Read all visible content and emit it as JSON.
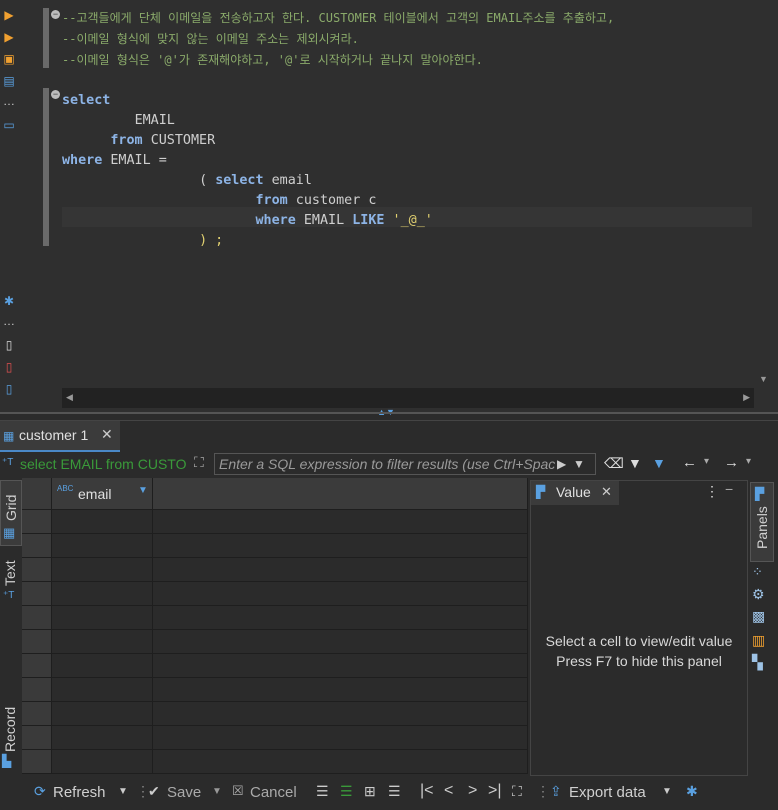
{
  "editor": {
    "comments": [
      "--고객들에게 단체 이메일을 전송하고자 한다. CUSTOMER 테이블에서 고객의 EMAIL주소를 추출하고,",
      "--이메일 형식에 맞지 않는 이메일 주소는 제외시켜라.",
      "--이메일 형식은 '@'가 존재해야하고, '@'로 시작하거나 끝나지 말아야한다."
    ],
    "sql": {
      "kw_select": "select",
      "col_email": "EMAIL",
      "kw_from": "from",
      "tbl_customer": "CUSTOMER",
      "kw_where": "where",
      "where_lhs": "EMAIL =",
      "paren_open": "( ",
      "kw_select2": "select",
      "col_email2": " email",
      "kw_from2": "from",
      "tbl_customer2": " customer c",
      "kw_where2": "where",
      "where2_lhs": " EMAIL ",
      "kw_like": "LIKE",
      "like_pattern": " '_@_'",
      "close": ") ;"
    }
  },
  "results": {
    "tab_label": "customer 1",
    "filter_sql": "select EMAIL from CUSTO",
    "filter_placeholder": "Enter a SQL expression to filter results (use Ctrl+Space)",
    "column_header": "email",
    "side_tabs": [
      "Grid",
      "Text",
      "Record"
    ],
    "value_panel": {
      "title": "Value",
      "hint_line1": "Select a cell to view/edit value",
      "hint_line2": "Press F7 to hide this panel"
    },
    "panels_label": "Panels",
    "bottom": {
      "refresh": "Refresh",
      "save": "Save",
      "cancel": "Cancel",
      "export": "Export data"
    }
  },
  "colors": {
    "keyword": "#8db4e6",
    "comment": "#8aaa6a",
    "string": "#e0d070",
    "accent": "#4a88c7"
  }
}
